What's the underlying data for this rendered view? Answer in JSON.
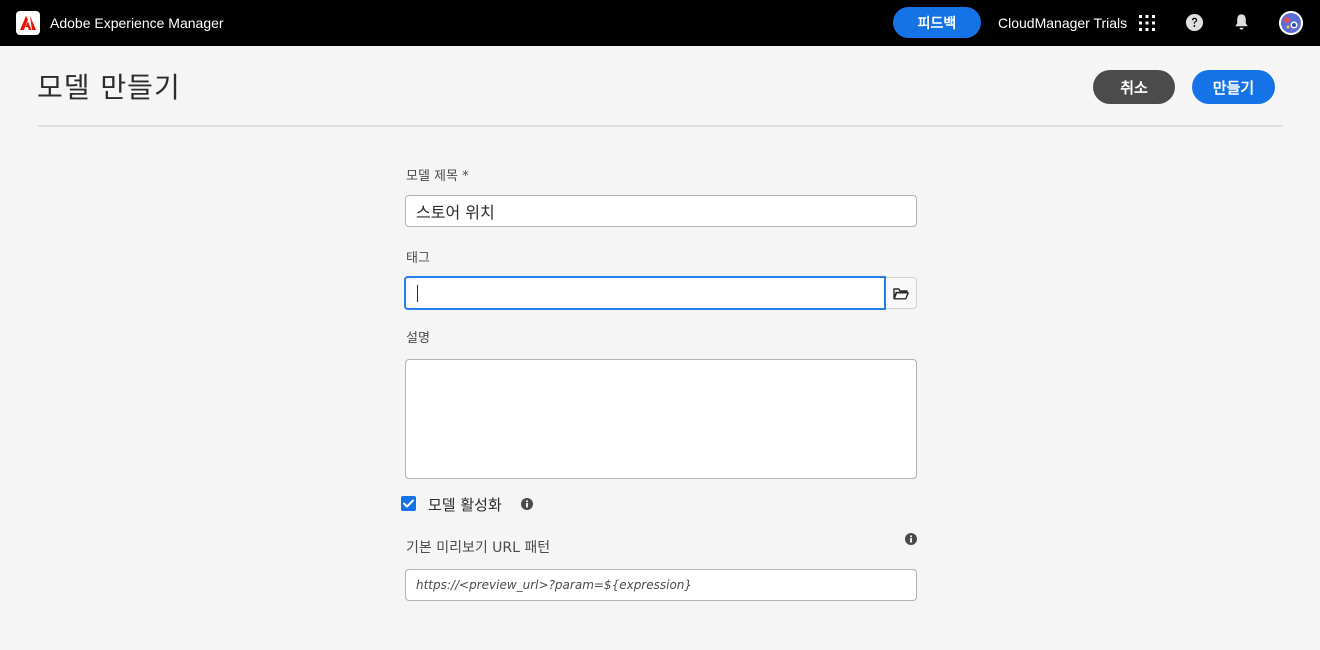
{
  "app": {
    "title": "Adobe Experience Manager",
    "feedback_label": "피드백",
    "org_name": "CloudManager Trials"
  },
  "header": {
    "page_title": "모델 만들기",
    "cancel_label": "취소",
    "create_label": "만들기"
  },
  "form": {
    "model_title_label": "모델 제목 *",
    "model_title_value": "스토어 위치",
    "tags_label": "태그",
    "tags_value": "",
    "description_label": "설명",
    "description_value": "",
    "enable_model_label": "모델 활성화",
    "enable_model_checked": true,
    "preview_url_label": "기본 미리보기 URL 패턴",
    "preview_url_placeholder": "https://<preview_url>?param=${expression}"
  },
  "icons": {
    "logo": "adobe-logo-icon",
    "apps": "apps-grid-icon",
    "help": "help-icon",
    "notifications": "bell-icon",
    "avatar": "avatar",
    "folder": "folder-open-icon",
    "info": "info-icon"
  },
  "colors": {
    "accent": "#1473e6",
    "topbar": "#000000",
    "cancel": "#4b4b4b",
    "logo_red": "#eb1000"
  }
}
